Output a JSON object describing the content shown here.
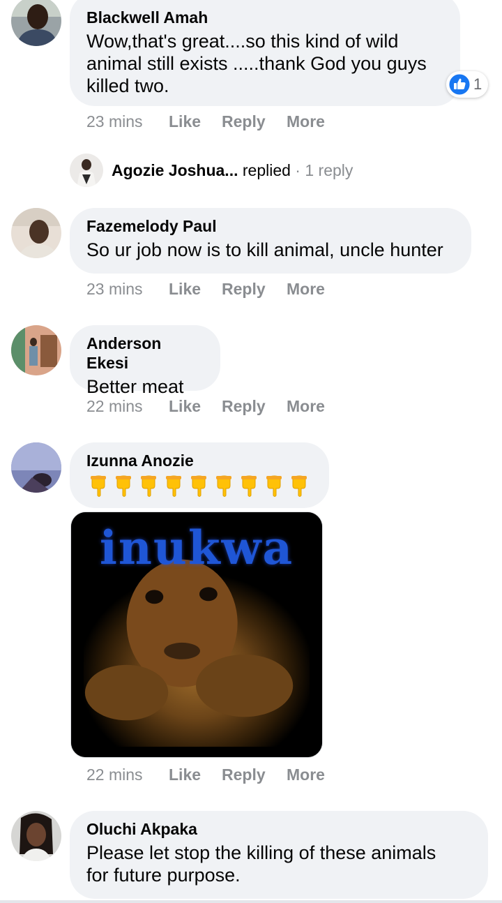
{
  "comments": [
    {
      "author": "Blackwell Amah",
      "text": "Wow,that's great....so this kind of wild\nanimal still exists .....thank God you guys\nkilled two.",
      "time": "23 mins",
      "like": "Like",
      "reply": "Reply",
      "more": "More",
      "reaction": {
        "icon": "thumbs-up-icon",
        "count": "1",
        "color": "#1877f2"
      }
    },
    {
      "author": "Fazemelody Paul",
      "text": "So ur job now is to kill animal, uncle hunter",
      "time": "23 mins",
      "like": "Like",
      "reply": "Reply",
      "more": "More"
    },
    {
      "author": "Anderson Ekesi",
      "text": "Better meat",
      "time": "22 mins",
      "like": "Like",
      "reply": "Reply",
      "more": "More"
    },
    {
      "author": "Izunna Anozie",
      "emoji": "backhand-index-pointing-down-icon",
      "emoji_count": 9,
      "attachment_text": "inukwa",
      "time": "22 mins",
      "like": "Like",
      "reply": "Reply",
      "more": "More"
    },
    {
      "author": "Oluchi Akpaka",
      "text": "Please let stop the killing of these animals\nfor future purpose."
    }
  ],
  "reply_preview": {
    "name": "Agozie Joshua...",
    "action": " replied",
    "separator": " · ",
    "count": "1 reply"
  }
}
